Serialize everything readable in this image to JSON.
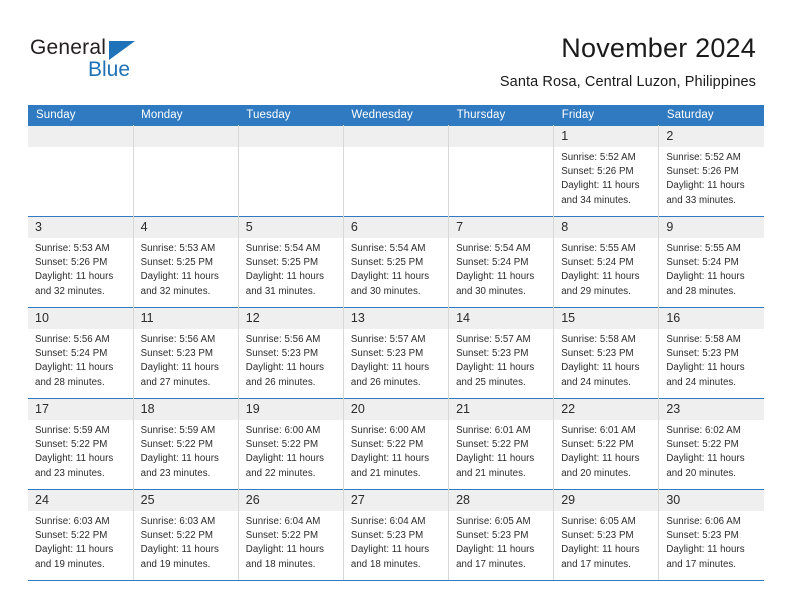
{
  "brand": {
    "name_part1": "General",
    "name_part2": "Blue",
    "triangle_color": "#1d72b8"
  },
  "header": {
    "title": "November 2024",
    "subtitle": "Santa Rosa, Central Luzon, Philippines"
  },
  "theme": {
    "header_blue": "#2f7ac1",
    "daynum_band": "#efefef",
    "text": "#2b2b2b"
  },
  "weekdays": [
    "Sunday",
    "Monday",
    "Tuesday",
    "Wednesday",
    "Thursday",
    "Friday",
    "Saturday"
  ],
  "weeks": [
    [
      {
        "day": "",
        "empty": true
      },
      {
        "day": "",
        "empty": true
      },
      {
        "day": "",
        "empty": true
      },
      {
        "day": "",
        "empty": true
      },
      {
        "day": "",
        "empty": true
      },
      {
        "day": "1",
        "sunrise": "Sunrise: 5:52 AM",
        "sunset": "Sunset: 5:26 PM",
        "daylight_line1": "Daylight: 11 hours",
        "daylight_line2": "and 34 minutes."
      },
      {
        "day": "2",
        "sunrise": "Sunrise: 5:52 AM",
        "sunset": "Sunset: 5:26 PM",
        "daylight_line1": "Daylight: 11 hours",
        "daylight_line2": "and 33 minutes."
      }
    ],
    [
      {
        "day": "3",
        "sunrise": "Sunrise: 5:53 AM",
        "sunset": "Sunset: 5:26 PM",
        "daylight_line1": "Daylight: 11 hours",
        "daylight_line2": "and 32 minutes."
      },
      {
        "day": "4",
        "sunrise": "Sunrise: 5:53 AM",
        "sunset": "Sunset: 5:25 PM",
        "daylight_line1": "Daylight: 11 hours",
        "daylight_line2": "and 32 minutes."
      },
      {
        "day": "5",
        "sunrise": "Sunrise: 5:54 AM",
        "sunset": "Sunset: 5:25 PM",
        "daylight_line1": "Daylight: 11 hours",
        "daylight_line2": "and 31 minutes."
      },
      {
        "day": "6",
        "sunrise": "Sunrise: 5:54 AM",
        "sunset": "Sunset: 5:25 PM",
        "daylight_line1": "Daylight: 11 hours",
        "daylight_line2": "and 30 minutes."
      },
      {
        "day": "7",
        "sunrise": "Sunrise: 5:54 AM",
        "sunset": "Sunset: 5:24 PM",
        "daylight_line1": "Daylight: 11 hours",
        "daylight_line2": "and 30 minutes."
      },
      {
        "day": "8",
        "sunrise": "Sunrise: 5:55 AM",
        "sunset": "Sunset: 5:24 PM",
        "daylight_line1": "Daylight: 11 hours",
        "daylight_line2": "and 29 minutes."
      },
      {
        "day": "9",
        "sunrise": "Sunrise: 5:55 AM",
        "sunset": "Sunset: 5:24 PM",
        "daylight_line1": "Daylight: 11 hours",
        "daylight_line2": "and 28 minutes."
      }
    ],
    [
      {
        "day": "10",
        "sunrise": "Sunrise: 5:56 AM",
        "sunset": "Sunset: 5:24 PM",
        "daylight_line1": "Daylight: 11 hours",
        "daylight_line2": "and 28 minutes."
      },
      {
        "day": "11",
        "sunrise": "Sunrise: 5:56 AM",
        "sunset": "Sunset: 5:23 PM",
        "daylight_line1": "Daylight: 11 hours",
        "daylight_line2": "and 27 minutes."
      },
      {
        "day": "12",
        "sunrise": "Sunrise: 5:56 AM",
        "sunset": "Sunset: 5:23 PM",
        "daylight_line1": "Daylight: 11 hours",
        "daylight_line2": "and 26 minutes."
      },
      {
        "day": "13",
        "sunrise": "Sunrise: 5:57 AM",
        "sunset": "Sunset: 5:23 PM",
        "daylight_line1": "Daylight: 11 hours",
        "daylight_line2": "and 26 minutes."
      },
      {
        "day": "14",
        "sunrise": "Sunrise: 5:57 AM",
        "sunset": "Sunset: 5:23 PM",
        "daylight_line1": "Daylight: 11 hours",
        "daylight_line2": "and 25 minutes."
      },
      {
        "day": "15",
        "sunrise": "Sunrise: 5:58 AM",
        "sunset": "Sunset: 5:23 PM",
        "daylight_line1": "Daylight: 11 hours",
        "daylight_line2": "and 24 minutes."
      },
      {
        "day": "16",
        "sunrise": "Sunrise: 5:58 AM",
        "sunset": "Sunset: 5:23 PM",
        "daylight_line1": "Daylight: 11 hours",
        "daylight_line2": "and 24 minutes."
      }
    ],
    [
      {
        "day": "17",
        "sunrise": "Sunrise: 5:59 AM",
        "sunset": "Sunset: 5:22 PM",
        "daylight_line1": "Daylight: 11 hours",
        "daylight_line2": "and 23 minutes."
      },
      {
        "day": "18",
        "sunrise": "Sunrise: 5:59 AM",
        "sunset": "Sunset: 5:22 PM",
        "daylight_line1": "Daylight: 11 hours",
        "daylight_line2": "and 23 minutes."
      },
      {
        "day": "19",
        "sunrise": "Sunrise: 6:00 AM",
        "sunset": "Sunset: 5:22 PM",
        "daylight_line1": "Daylight: 11 hours",
        "daylight_line2": "and 22 minutes."
      },
      {
        "day": "20",
        "sunrise": "Sunrise: 6:00 AM",
        "sunset": "Sunset: 5:22 PM",
        "daylight_line1": "Daylight: 11 hours",
        "daylight_line2": "and 21 minutes."
      },
      {
        "day": "21",
        "sunrise": "Sunrise: 6:01 AM",
        "sunset": "Sunset: 5:22 PM",
        "daylight_line1": "Daylight: 11 hours",
        "daylight_line2": "and 21 minutes."
      },
      {
        "day": "22",
        "sunrise": "Sunrise: 6:01 AM",
        "sunset": "Sunset: 5:22 PM",
        "daylight_line1": "Daylight: 11 hours",
        "daylight_line2": "and 20 minutes."
      },
      {
        "day": "23",
        "sunrise": "Sunrise: 6:02 AM",
        "sunset": "Sunset: 5:22 PM",
        "daylight_line1": "Daylight: 11 hours",
        "daylight_line2": "and 20 minutes."
      }
    ],
    [
      {
        "day": "24",
        "sunrise": "Sunrise: 6:03 AM",
        "sunset": "Sunset: 5:22 PM",
        "daylight_line1": "Daylight: 11 hours",
        "daylight_line2": "and 19 minutes."
      },
      {
        "day": "25",
        "sunrise": "Sunrise: 6:03 AM",
        "sunset": "Sunset: 5:22 PM",
        "daylight_line1": "Daylight: 11 hours",
        "daylight_line2": "and 19 minutes."
      },
      {
        "day": "26",
        "sunrise": "Sunrise: 6:04 AM",
        "sunset": "Sunset: 5:22 PM",
        "daylight_line1": "Daylight: 11 hours",
        "daylight_line2": "and 18 minutes."
      },
      {
        "day": "27",
        "sunrise": "Sunrise: 6:04 AM",
        "sunset": "Sunset: 5:23 PM",
        "daylight_line1": "Daylight: 11 hours",
        "daylight_line2": "and 18 minutes."
      },
      {
        "day": "28",
        "sunrise": "Sunrise: 6:05 AM",
        "sunset": "Sunset: 5:23 PM",
        "daylight_line1": "Daylight: 11 hours",
        "daylight_line2": "and 17 minutes."
      },
      {
        "day": "29",
        "sunrise": "Sunrise: 6:05 AM",
        "sunset": "Sunset: 5:23 PM",
        "daylight_line1": "Daylight: 11 hours",
        "daylight_line2": "and 17 minutes."
      },
      {
        "day": "30",
        "sunrise": "Sunrise: 6:06 AM",
        "sunset": "Sunset: 5:23 PM",
        "daylight_line1": "Daylight: 11 hours",
        "daylight_line2": "and 17 minutes."
      }
    ]
  ]
}
